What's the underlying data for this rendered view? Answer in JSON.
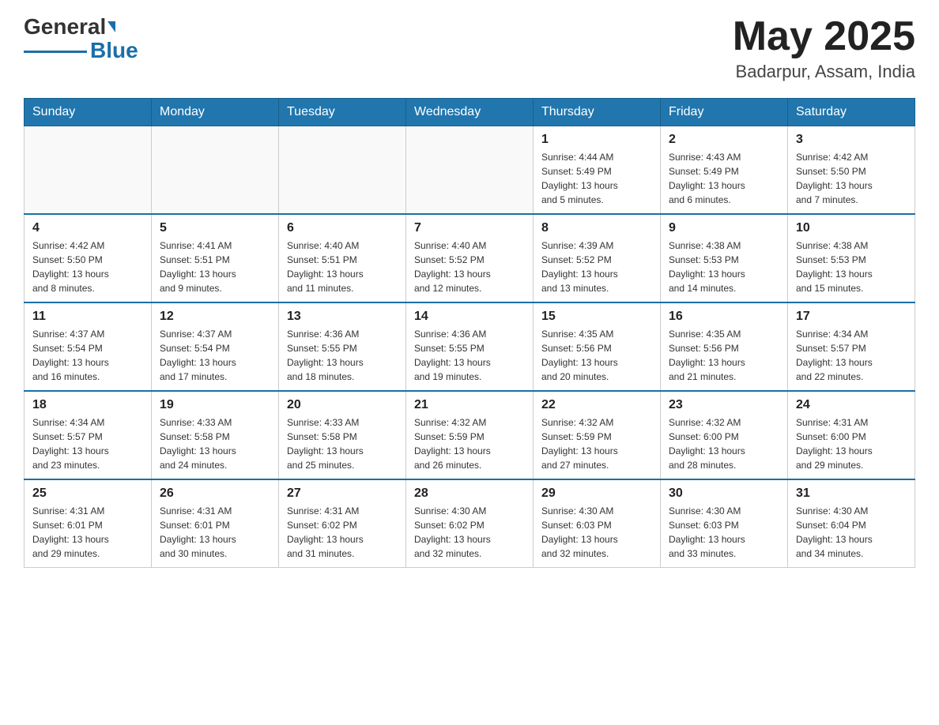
{
  "header": {
    "logo_text1": "General",
    "logo_text2": "Blue",
    "month_year": "May 2025",
    "location": "Badarpur, Assam, India"
  },
  "days_of_week": [
    "Sunday",
    "Monday",
    "Tuesday",
    "Wednesday",
    "Thursday",
    "Friday",
    "Saturday"
  ],
  "weeks": [
    [
      {
        "day": "",
        "info": ""
      },
      {
        "day": "",
        "info": ""
      },
      {
        "day": "",
        "info": ""
      },
      {
        "day": "",
        "info": ""
      },
      {
        "day": "1",
        "info": "Sunrise: 4:44 AM\nSunset: 5:49 PM\nDaylight: 13 hours\nand 5 minutes."
      },
      {
        "day": "2",
        "info": "Sunrise: 4:43 AM\nSunset: 5:49 PM\nDaylight: 13 hours\nand 6 minutes."
      },
      {
        "day": "3",
        "info": "Sunrise: 4:42 AM\nSunset: 5:50 PM\nDaylight: 13 hours\nand 7 minutes."
      }
    ],
    [
      {
        "day": "4",
        "info": "Sunrise: 4:42 AM\nSunset: 5:50 PM\nDaylight: 13 hours\nand 8 minutes."
      },
      {
        "day": "5",
        "info": "Sunrise: 4:41 AM\nSunset: 5:51 PM\nDaylight: 13 hours\nand 9 minutes."
      },
      {
        "day": "6",
        "info": "Sunrise: 4:40 AM\nSunset: 5:51 PM\nDaylight: 13 hours\nand 11 minutes."
      },
      {
        "day": "7",
        "info": "Sunrise: 4:40 AM\nSunset: 5:52 PM\nDaylight: 13 hours\nand 12 minutes."
      },
      {
        "day": "8",
        "info": "Sunrise: 4:39 AM\nSunset: 5:52 PM\nDaylight: 13 hours\nand 13 minutes."
      },
      {
        "day": "9",
        "info": "Sunrise: 4:38 AM\nSunset: 5:53 PM\nDaylight: 13 hours\nand 14 minutes."
      },
      {
        "day": "10",
        "info": "Sunrise: 4:38 AM\nSunset: 5:53 PM\nDaylight: 13 hours\nand 15 minutes."
      }
    ],
    [
      {
        "day": "11",
        "info": "Sunrise: 4:37 AM\nSunset: 5:54 PM\nDaylight: 13 hours\nand 16 minutes."
      },
      {
        "day": "12",
        "info": "Sunrise: 4:37 AM\nSunset: 5:54 PM\nDaylight: 13 hours\nand 17 minutes."
      },
      {
        "day": "13",
        "info": "Sunrise: 4:36 AM\nSunset: 5:55 PM\nDaylight: 13 hours\nand 18 minutes."
      },
      {
        "day": "14",
        "info": "Sunrise: 4:36 AM\nSunset: 5:55 PM\nDaylight: 13 hours\nand 19 minutes."
      },
      {
        "day": "15",
        "info": "Sunrise: 4:35 AM\nSunset: 5:56 PM\nDaylight: 13 hours\nand 20 minutes."
      },
      {
        "day": "16",
        "info": "Sunrise: 4:35 AM\nSunset: 5:56 PM\nDaylight: 13 hours\nand 21 minutes."
      },
      {
        "day": "17",
        "info": "Sunrise: 4:34 AM\nSunset: 5:57 PM\nDaylight: 13 hours\nand 22 minutes."
      }
    ],
    [
      {
        "day": "18",
        "info": "Sunrise: 4:34 AM\nSunset: 5:57 PM\nDaylight: 13 hours\nand 23 minutes."
      },
      {
        "day": "19",
        "info": "Sunrise: 4:33 AM\nSunset: 5:58 PM\nDaylight: 13 hours\nand 24 minutes."
      },
      {
        "day": "20",
        "info": "Sunrise: 4:33 AM\nSunset: 5:58 PM\nDaylight: 13 hours\nand 25 minutes."
      },
      {
        "day": "21",
        "info": "Sunrise: 4:32 AM\nSunset: 5:59 PM\nDaylight: 13 hours\nand 26 minutes."
      },
      {
        "day": "22",
        "info": "Sunrise: 4:32 AM\nSunset: 5:59 PM\nDaylight: 13 hours\nand 27 minutes."
      },
      {
        "day": "23",
        "info": "Sunrise: 4:32 AM\nSunset: 6:00 PM\nDaylight: 13 hours\nand 28 minutes."
      },
      {
        "day": "24",
        "info": "Sunrise: 4:31 AM\nSunset: 6:00 PM\nDaylight: 13 hours\nand 29 minutes."
      }
    ],
    [
      {
        "day": "25",
        "info": "Sunrise: 4:31 AM\nSunset: 6:01 PM\nDaylight: 13 hours\nand 29 minutes."
      },
      {
        "day": "26",
        "info": "Sunrise: 4:31 AM\nSunset: 6:01 PM\nDaylight: 13 hours\nand 30 minutes."
      },
      {
        "day": "27",
        "info": "Sunrise: 4:31 AM\nSunset: 6:02 PM\nDaylight: 13 hours\nand 31 minutes."
      },
      {
        "day": "28",
        "info": "Sunrise: 4:30 AM\nSunset: 6:02 PM\nDaylight: 13 hours\nand 32 minutes."
      },
      {
        "day": "29",
        "info": "Sunrise: 4:30 AM\nSunset: 6:03 PM\nDaylight: 13 hours\nand 32 minutes."
      },
      {
        "day": "30",
        "info": "Sunrise: 4:30 AM\nSunset: 6:03 PM\nDaylight: 13 hours\nand 33 minutes."
      },
      {
        "day": "31",
        "info": "Sunrise: 4:30 AM\nSunset: 6:04 PM\nDaylight: 13 hours\nand 34 minutes."
      }
    ]
  ]
}
